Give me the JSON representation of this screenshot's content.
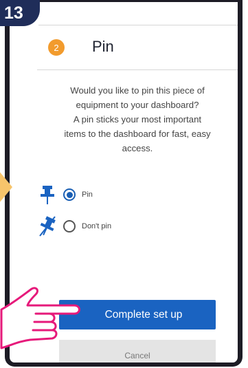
{
  "step_badge": "13",
  "header": {
    "step_number": "2",
    "title": "Pin"
  },
  "description": [
    "Would you like to pin this piece of",
    "equipment to your dashboard?",
    "A pin sticks your most important",
    "items to the dashboard for fast, easy",
    "access."
  ],
  "options": [
    {
      "label": "Pin",
      "selected": true,
      "icon": "pin-icon"
    },
    {
      "label": "Don't pin",
      "selected": false,
      "icon": "unpin-icon"
    }
  ],
  "buttons": {
    "complete": "Complete set up",
    "cancel": "Cancel"
  },
  "colors": {
    "accent_blue": "#1a63c1",
    "step_orange": "#f29b2d",
    "badge_navy": "#1f2d59",
    "hand_pink": "#e6197a",
    "arrow_yellow": "#f7c46b"
  }
}
